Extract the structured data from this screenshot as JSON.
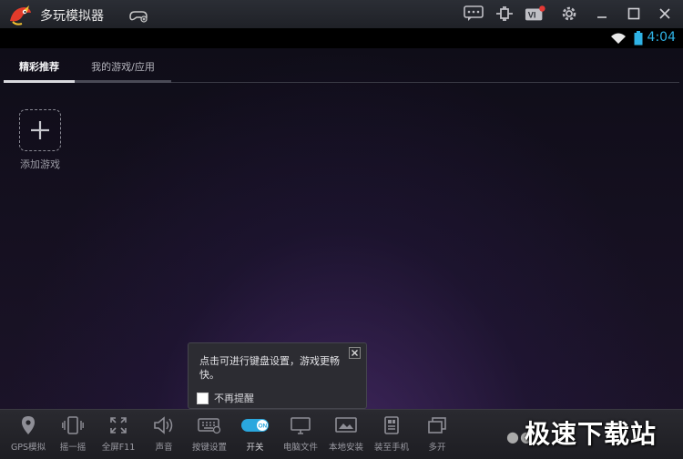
{
  "window": {
    "title": "多玩模拟器"
  },
  "status": {
    "time": "4:04"
  },
  "tabs": [
    {
      "label": "精彩推荐",
      "active": true
    },
    {
      "label": "我的游戏/应用",
      "active": false
    }
  ],
  "add_game": {
    "label": "添加游戏"
  },
  "popup": {
    "message": "点击可进行键盘设置，游戏更畅快。",
    "checkbox_label": "不再提醒"
  },
  "toolbar": [
    {
      "label": "GPS模拟",
      "icon": "location-pin-icon"
    },
    {
      "label": "摇一摇",
      "icon": "shake-icon"
    },
    {
      "label": "全屏F11",
      "icon": "fullscreen-icon"
    },
    {
      "label": "声音",
      "icon": "volume-icon"
    },
    {
      "label": "按键设置",
      "icon": "keyboard-icon"
    },
    {
      "label": "开关",
      "icon": "toggle-on-icon",
      "toggle_text": "ON"
    },
    {
      "label": "电脑文件",
      "icon": "monitor-icon"
    },
    {
      "label": "本地安装",
      "icon": "install-icon"
    },
    {
      "label": "装至手机",
      "icon": "phone-install-icon"
    },
    {
      "label": "多开",
      "icon": "multi-window-icon"
    }
  ],
  "watermark": "极速下载站",
  "colors": {
    "accent": "#2fb3e6",
    "toggle": "#2aa7de"
  }
}
